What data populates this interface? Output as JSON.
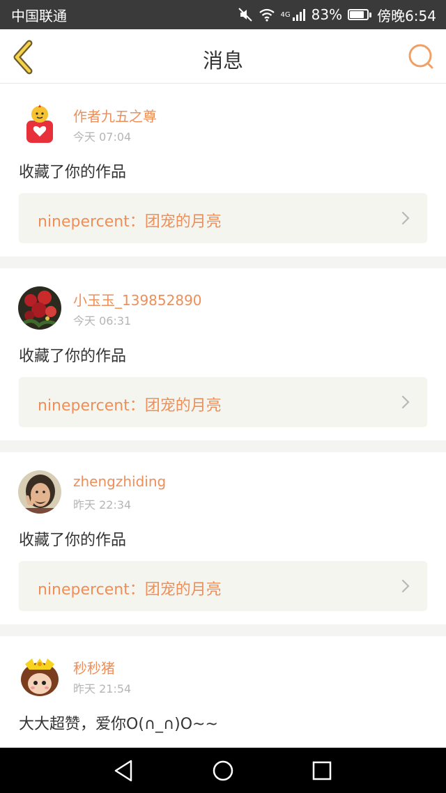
{
  "status_bar": {
    "carrier": "中国联通",
    "network": "4G",
    "battery_percent": "83%",
    "battery_level": 0.83,
    "time": "傍晚6:54"
  },
  "nav": {
    "title": "消息",
    "back_icon": "back-chevron-icon",
    "search_icon": "search-icon",
    "accent_color": "#ee8e58"
  },
  "messages": [
    {
      "username": "作者九五之尊",
      "time": "今天 07:04",
      "action": "收藏了你的作品",
      "work": "ninepercent：团宠的月亮",
      "avatar_icon": "gift-mascot-avatar"
    },
    {
      "username": "小玉玉_139852890",
      "time": "今天 06:31",
      "action": "收藏了你的作品",
      "work": "ninepercent：团宠的月亮",
      "avatar_icon": "roses-avatar"
    },
    {
      "username": "zhengzhiding",
      "time": "昨天 22:34",
      "action": "收藏了你的作品",
      "work": "ninepercent：团宠的月亮",
      "avatar_icon": "man-peace-sign-avatar"
    },
    {
      "username": "秒秒猪",
      "time": "昨天 21:54",
      "action": "大大超赞，爱你O(∩_∩)O~~",
      "avatar_icon": "cartoon-girl-avatar"
    }
  ],
  "system_nav": {
    "back_icon": "triangle-back-icon",
    "home_icon": "circle-home-icon",
    "recents_icon": "square-recents-icon"
  }
}
